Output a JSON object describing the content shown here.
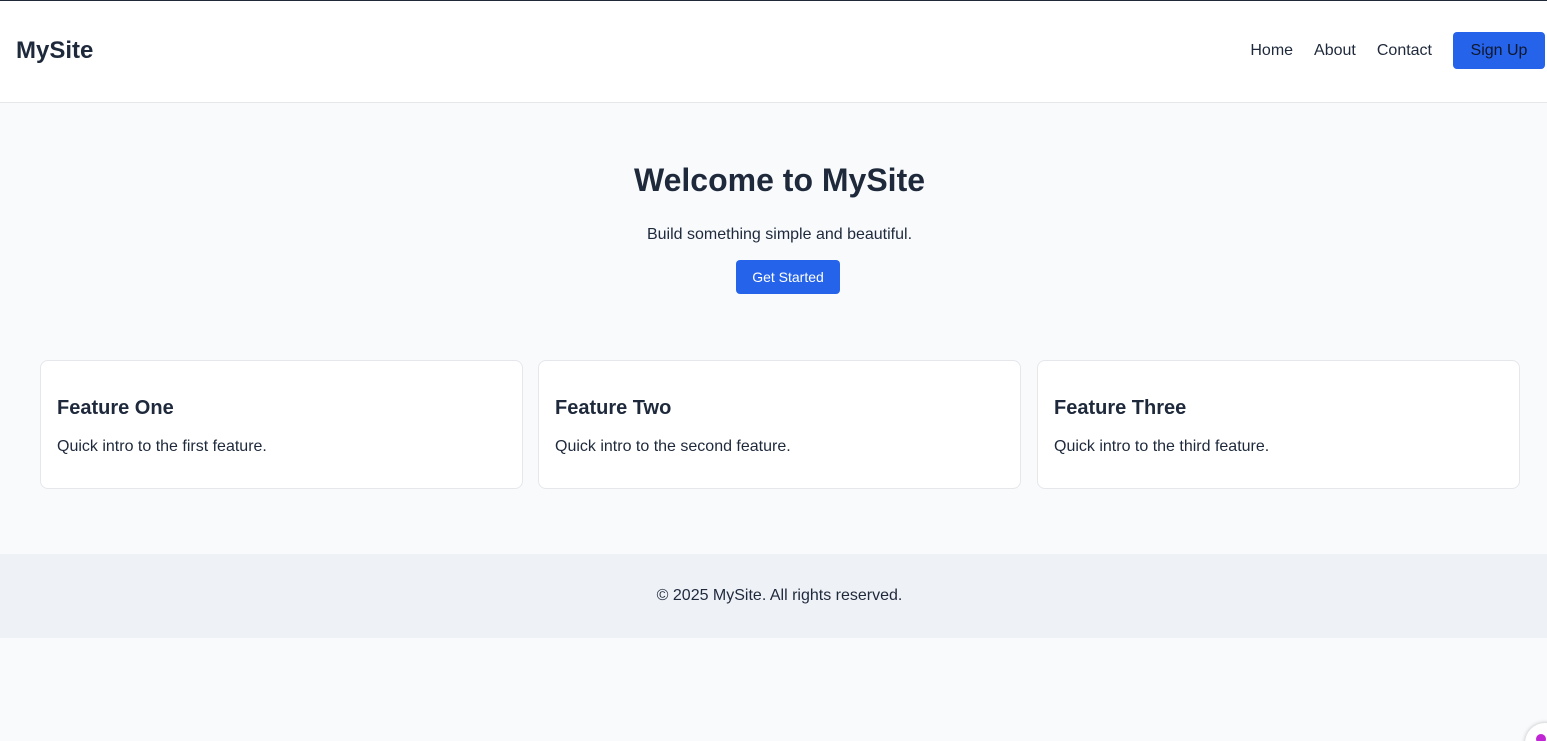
{
  "header": {
    "logo": "MySite",
    "nav": [
      "Home",
      "About",
      "Contact"
    ],
    "signup_label": "Sign Up"
  },
  "hero": {
    "title": "Welcome to MySite",
    "subtitle": "Build something simple and beautiful.",
    "cta_label": "Get Started"
  },
  "features": [
    {
      "title": "Feature One",
      "text": "Quick intro to the first feature."
    },
    {
      "title": "Feature Two",
      "text": "Quick intro to the second feature."
    },
    {
      "title": "Feature Three",
      "text": "Quick intro to the third feature."
    }
  ],
  "footer": {
    "text": "© 2025 MySite. All rights reserved."
  },
  "colors": {
    "accent": "#2563eb",
    "text": "#1e293b",
    "background": "#f8fafc",
    "footer_bg": "#eef1f6"
  },
  "icons": {
    "corner_badge": "assistant-badge-icon"
  }
}
